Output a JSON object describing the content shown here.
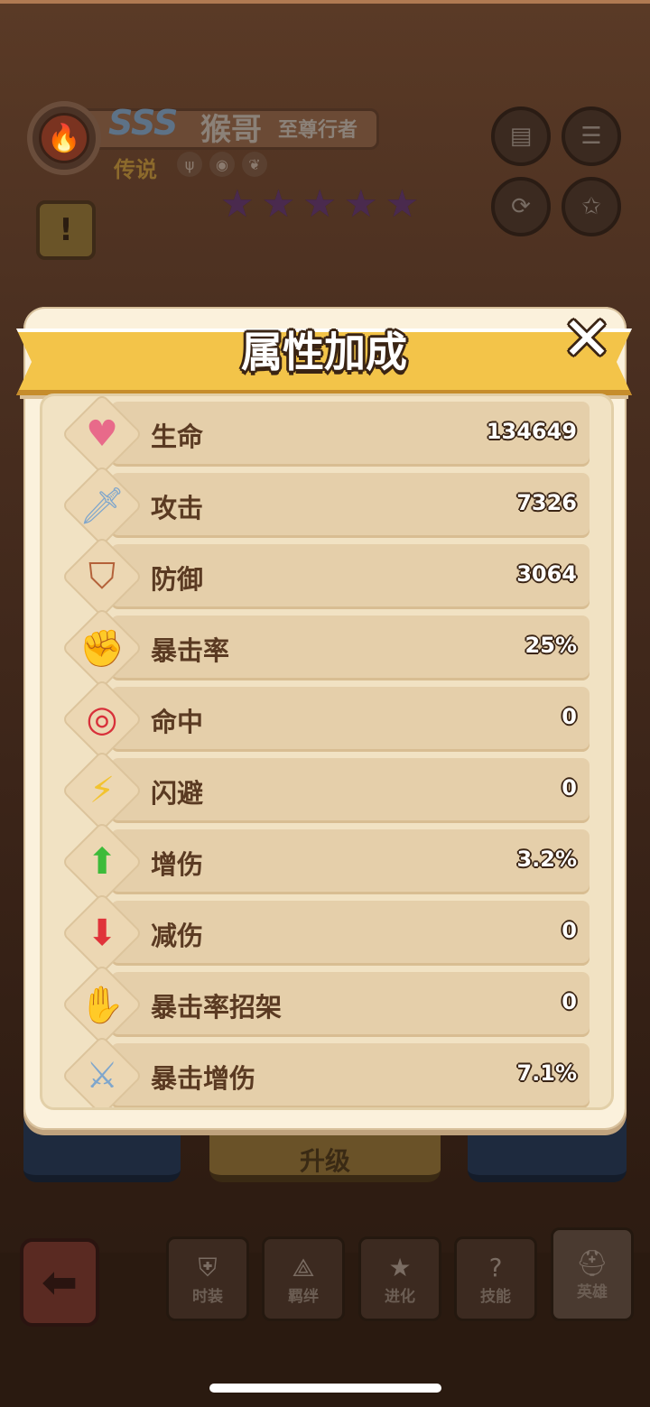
{
  "hero": {
    "grade": "SSS",
    "name": "猴哥",
    "title": "至尊行者",
    "rarity": "传说",
    "faction_icons": [
      "claw-icon",
      "beast-icon",
      "leaf-icon"
    ],
    "star_count": 5,
    "colors": {
      "grade": "#5d7287",
      "star": "#4a2a4e"
    }
  },
  "top_buttons": [
    "book-icon",
    "scroll-icon",
    "horn-swap-icon",
    "star-swap-icon"
  ],
  "modal": {
    "title": "属性加成",
    "close_icon": "close-icon",
    "stats": [
      {
        "label": "生命",
        "value": "134649",
        "icon": "heart-icon"
      },
      {
        "label": "攻击",
        "value": "7326",
        "icon": "sword-icon"
      },
      {
        "label": "防御",
        "value": "3064",
        "icon": "shield-icon"
      },
      {
        "label": "暴击率",
        "value": "25%",
        "icon": "fist-icon"
      },
      {
        "label": "命中",
        "value": "0",
        "icon": "target-icon"
      },
      {
        "label": "闪避",
        "value": "0",
        "icon": "lightning-icon"
      },
      {
        "label": "增伤",
        "value": "3.2%",
        "icon": "sword-up-icon"
      },
      {
        "label": "减伤",
        "value": "0",
        "icon": "sword-down-icon"
      },
      {
        "label": "暴击率招架",
        "value": "0",
        "icon": "parry-icon"
      },
      {
        "label": "暴击增伤",
        "value": "7.1%",
        "icon": "crit-damage-icon"
      }
    ]
  },
  "behind_buttons": {
    "upgrade": "升级"
  },
  "bottom_tabs": [
    {
      "label": "时装",
      "icon": "armor-icon"
    },
    {
      "label": "羁绊",
      "icon": "bond-icon"
    },
    {
      "label": "进化",
      "icon": "star-icon"
    },
    {
      "label": "技能",
      "icon": "skill-icon"
    },
    {
      "label": "英雄",
      "icon": "helmet-icon"
    }
  ],
  "colors": {
    "ribbon": "#f3c449",
    "modal_bg": "#fbf1dc",
    "row_bg": "#e5cfaa",
    "label": "#5a3a22"
  }
}
